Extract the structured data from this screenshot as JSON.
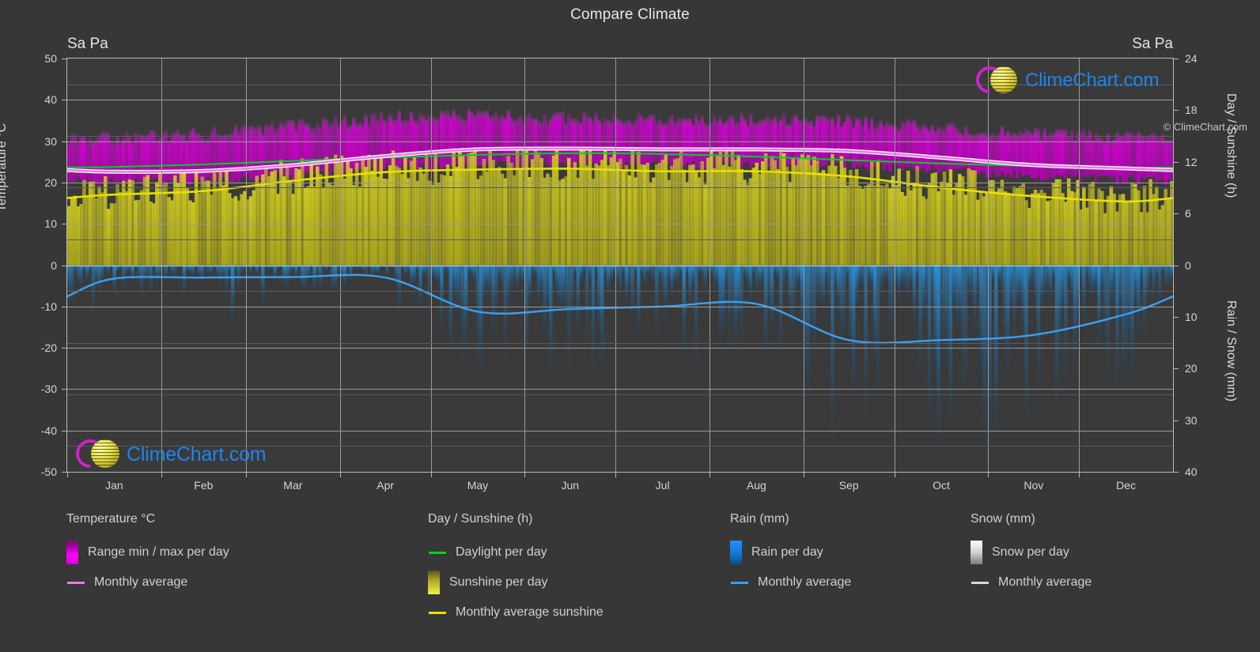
{
  "title": "Compare Climate",
  "location_left": "Sa Pa",
  "location_right": "Sa Pa",
  "brand": "ClimeChart.com",
  "copyright": "© ClimeChart.com",
  "axes": {
    "left_label": "Temperature °C",
    "right_top_label": "Day / Sunshine (h)",
    "right_bottom_label": "Rain / Snow (mm)",
    "left_ticks": [
      "50",
      "40",
      "30",
      "20",
      "10",
      "0",
      "-10",
      "-20",
      "-30",
      "-40",
      "-50"
    ],
    "right_top_ticks": [
      "24",
      "18",
      "12",
      "6",
      "0"
    ],
    "right_bottom_ticks": [
      "0",
      "10",
      "20",
      "30",
      "40"
    ],
    "x_ticks": [
      "Jan",
      "Feb",
      "Mar",
      "Apr",
      "May",
      "Jun",
      "Jul",
      "Aug",
      "Sep",
      "Oct",
      "Nov",
      "Dec"
    ]
  },
  "legend": {
    "columns": [
      {
        "heading": "Temperature °C",
        "items": [
          {
            "label": "Range min / max per day",
            "swatch": "gradient-magenta",
            "color": "#ff00ff"
          },
          {
            "label": "Monthly average",
            "swatch": "line",
            "color": "#e87ae8"
          }
        ]
      },
      {
        "heading": "Day / Sunshine (h)",
        "items": [
          {
            "label": "Daylight per day",
            "swatch": "line",
            "color": "#00d11e"
          },
          {
            "label": "Sunshine per day",
            "swatch": "gradient-yellow",
            "color": "#e8e84a"
          },
          {
            "label": "Monthly average sunshine",
            "swatch": "line",
            "color": "#e8e000"
          }
        ]
      },
      {
        "heading": "Rain (mm)",
        "items": [
          {
            "label": "Rain per day",
            "swatch": "gradient-blue",
            "color": "#1e90ff"
          },
          {
            "label": "Monthly average",
            "swatch": "line",
            "color": "#3aa0f0"
          }
        ]
      },
      {
        "heading": "Snow (mm)",
        "items": [
          {
            "label": "Snow per day",
            "swatch": "gradient-white",
            "color": "#f2f2f2"
          },
          {
            "label": "Monthly average",
            "swatch": "line",
            "color": "#d8d8d8"
          }
        ]
      }
    ]
  },
  "chart_data": {
    "type": "line",
    "title": "Compare Climate",
    "subtitle": "Sa Pa",
    "xlabel": "",
    "ylabel": "Temperature °C",
    "ylabel_right_top": "Day / Sunshine (h)",
    "ylabel_right_bottom": "Rain / Snow (mm)",
    "categories": [
      "Jan",
      "Feb",
      "Mar",
      "Apr",
      "May",
      "Jun",
      "Jul",
      "Aug",
      "Sep",
      "Oct",
      "Nov",
      "Dec"
    ],
    "ylim": [
      -50,
      50
    ],
    "ylim_right_top": [
      0,
      24
    ],
    "ylim_right_bottom": [
      40,
      0
    ],
    "grid": true,
    "legend_position": "below",
    "series": [
      {
        "name": "Monthly average temperature",
        "unit": "°C",
        "color": "#e87ae8",
        "axis": "left",
        "values": [
          22.6,
          22.8,
          24.2,
          26.4,
          28.0,
          28.2,
          28.0,
          28.0,
          27.6,
          26.0,
          24.2,
          23.4
        ]
      },
      {
        "name": "Range min per day",
        "unit": "°C",
        "color": "#c000c0",
        "axis": "left",
        "values": [
          20.0,
          20.4,
          21.6,
          23.2,
          24.2,
          24.4,
          24.2,
          24.2,
          24.0,
          23.0,
          21.4,
          20.6
        ]
      },
      {
        "name": "Range max per day",
        "unit": "°C",
        "color": "#ff00ff",
        "axis": "left",
        "values": [
          31.0,
          32.0,
          34.0,
          36.0,
          36.5,
          36.0,
          35.5,
          35.5,
          35.0,
          33.5,
          32.0,
          31.0
        ]
      },
      {
        "name": "Daylight per day",
        "unit": "h",
        "color": "#00d11e",
        "axis": "right_top",
        "values": [
          11.4,
          11.7,
          12.1,
          12.5,
          12.8,
          13.0,
          12.9,
          12.6,
          12.2,
          11.8,
          11.5,
          11.3
        ]
      },
      {
        "name": "Monthly average sunshine",
        "unit": "h",
        "color": "#e8e000",
        "axis": "right_top",
        "values": [
          8.2,
          8.6,
          9.8,
          10.8,
          11.1,
          11.2,
          10.9,
          10.9,
          10.3,
          9.0,
          8.0,
          7.4
        ]
      },
      {
        "name": "Monthly average rain",
        "unit": "mm",
        "color": "#3aa0f0",
        "axis": "right_bottom",
        "values": [
          2.6,
          2.4,
          2.3,
          2.4,
          9.0,
          8.5,
          8.0,
          7.5,
          14.5,
          14.5,
          13.5,
          9.5
        ]
      }
    ],
    "annotations": [
      {
        "text": "Sa Pa",
        "position": "top-left"
      },
      {
        "text": "Sa Pa",
        "position": "top-right"
      },
      {
        "text": "ClimeChart.com",
        "position": "top-right-inside"
      },
      {
        "text": "ClimeChart.com",
        "position": "bottom-left-inside"
      }
    ]
  }
}
